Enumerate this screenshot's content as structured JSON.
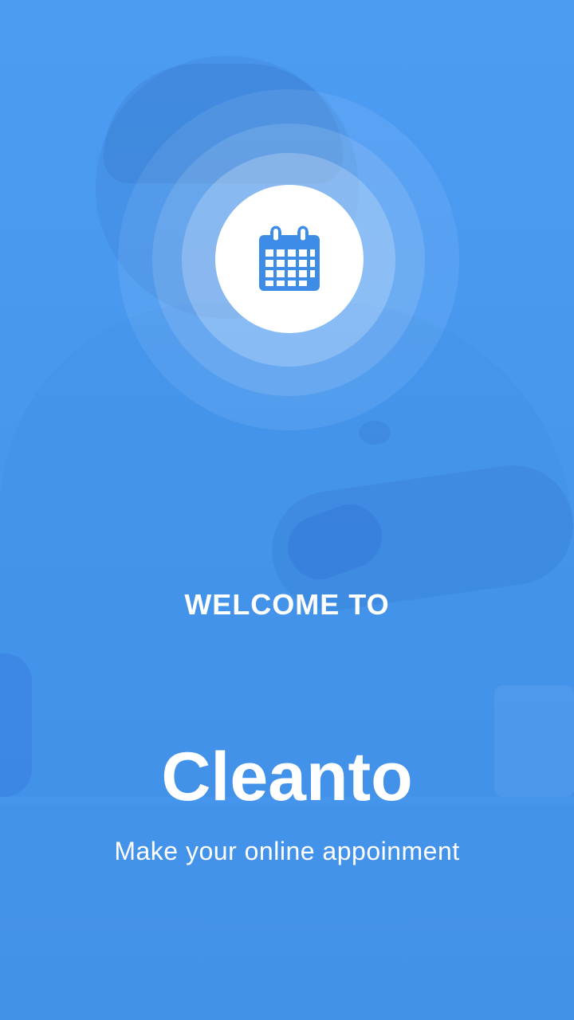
{
  "splash": {
    "welcome_text": "WELCOME TO",
    "app_name": "Cleanto",
    "tagline": "Make your online appoinment",
    "icon": "calendar-icon"
  },
  "colors": {
    "background": "#4a9af2",
    "accent": "#3d8ce8",
    "text": "#ffffff"
  }
}
